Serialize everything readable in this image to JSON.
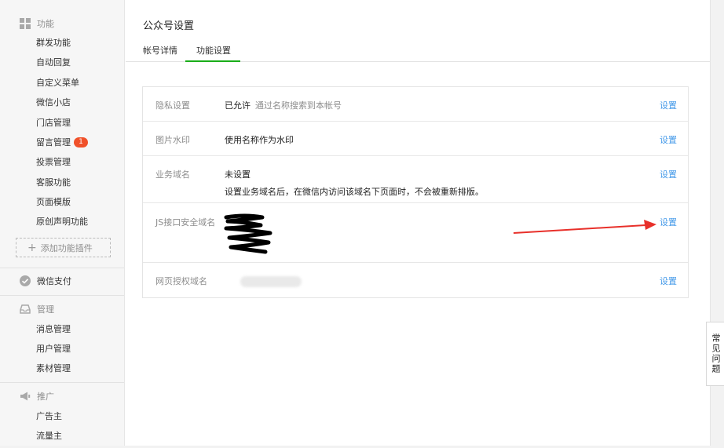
{
  "sidebar": {
    "groups": [
      {
        "title": "功能",
        "icon": "grid-icon",
        "items": [
          "群发功能",
          "自动回复",
          "自定义菜单",
          "微信小店",
          "门店管理",
          "留言管理",
          "投票管理",
          "客服功能",
          "页面模版",
          "原创声明功能"
        ]
      },
      {
        "title": "微信支付",
        "icon": "wechat-pay-icon",
        "items": []
      },
      {
        "title": "管理",
        "icon": "inbox-icon",
        "items": [
          "消息管理",
          "用户管理",
          "素材管理"
        ]
      },
      {
        "title": "推广",
        "icon": "megaphone-icon",
        "items": [
          "广告主",
          "流量主"
        ]
      }
    ],
    "badge_count": "1",
    "add_plugin_label": "添加功能插件"
  },
  "main": {
    "title": "公众号设置",
    "tabs": [
      {
        "label": "帐号详情",
        "active": false
      },
      {
        "label": "功能设置",
        "active": true
      }
    ],
    "rows": [
      {
        "label": "隐私设置",
        "value": "已允许",
        "hint": "通过名称搜索到本帐号",
        "action": "设置"
      },
      {
        "label": "图片水印",
        "value": "使用名称作为水印",
        "action": "设置"
      },
      {
        "label": "业务域名",
        "value": "未设置",
        "desc": "设置业务域名后，在微信内访问该域名下页面时，不会被重新排版。",
        "action": "设置"
      },
      {
        "label": "JS接口安全域名",
        "value": "",
        "action": "设置"
      },
      {
        "label": "网页授权域名",
        "value": "",
        "action": "设置"
      }
    ]
  },
  "faq_label": "常见问题",
  "colors": {
    "accent_green": "#1aad19",
    "link_blue": "#459ae9",
    "badge_red": "#f0512a",
    "annotation_red": "#e8302a"
  }
}
